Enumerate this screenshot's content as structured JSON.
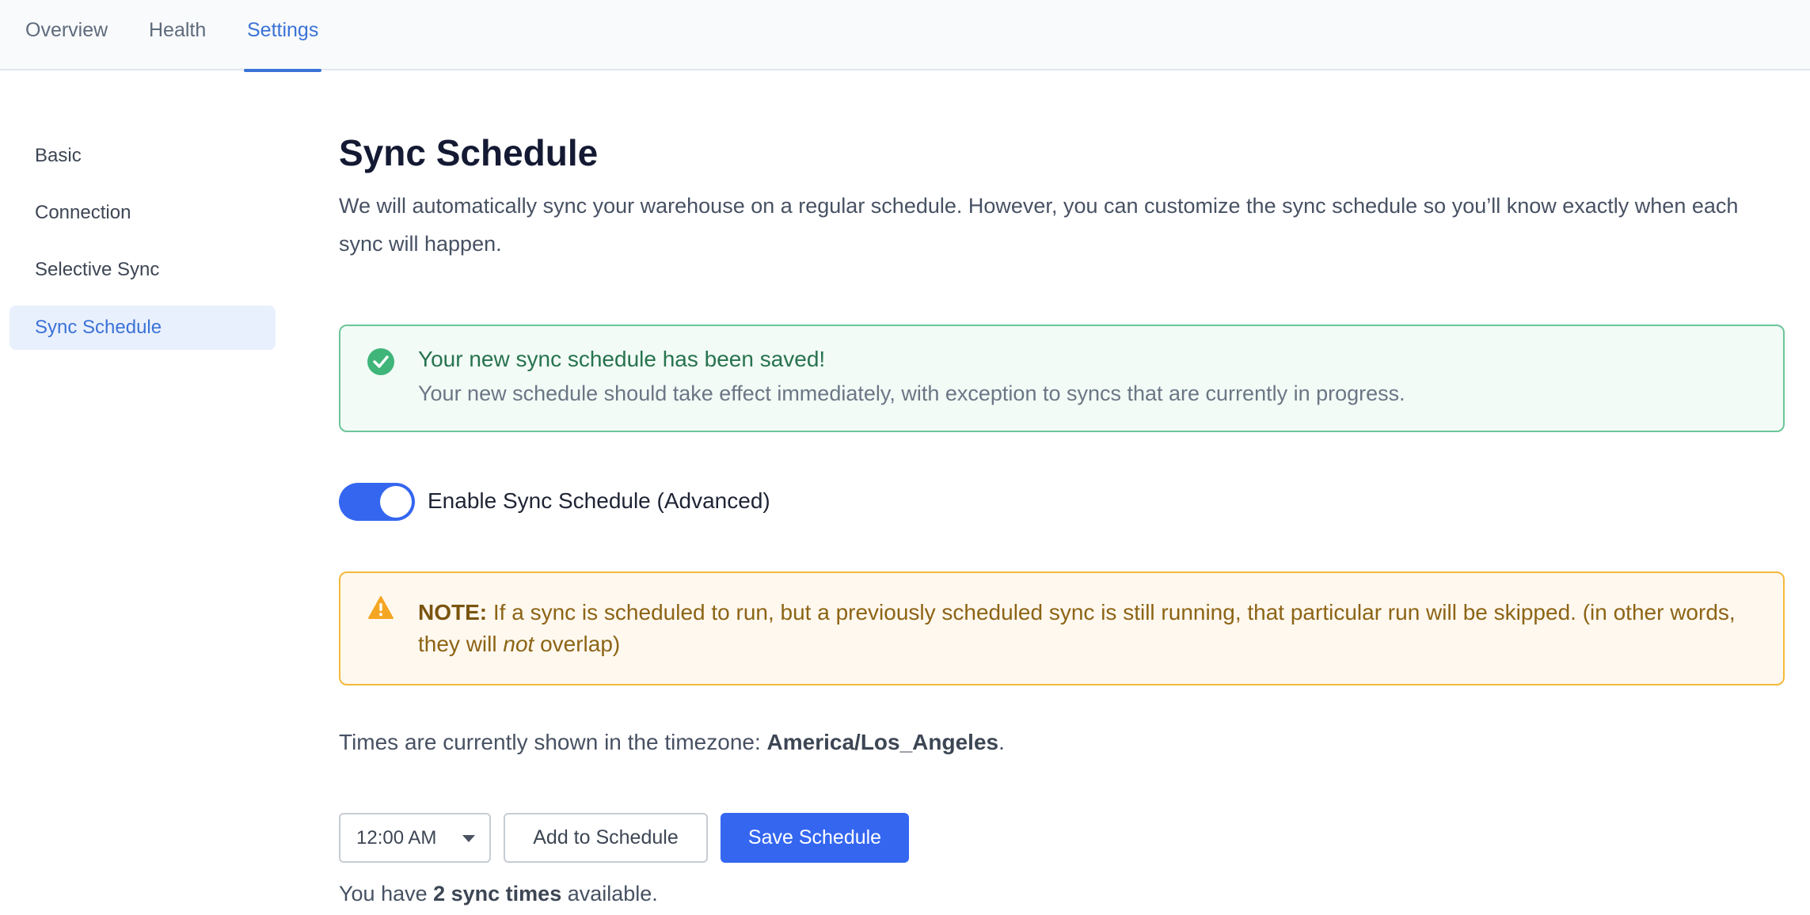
{
  "tabs": [
    {
      "label": "Overview"
    },
    {
      "label": "Health"
    },
    {
      "label": "Settings",
      "active": true
    }
  ],
  "sidebar": {
    "items": [
      {
        "label": "Basic"
      },
      {
        "label": "Connection"
      },
      {
        "label": "Selective Sync"
      },
      {
        "label": "Sync Schedule",
        "active": true
      }
    ]
  },
  "page": {
    "title": "Sync Schedule",
    "description": "We will automatically sync your warehouse on a regular schedule. However, you can customize the sync schedule so you’ll know exactly when each sync will happen."
  },
  "success_alert": {
    "icon": "check-circle-icon",
    "title": "Your new sync schedule has been saved!",
    "body": "Your new schedule should take effect immediately, with exception to syncs that are currently in progress.",
    "color": "#3fb579"
  },
  "toggle": {
    "label": "Enable Sync Schedule (Advanced)",
    "enabled": true,
    "color": "#3466f0"
  },
  "warning_alert": {
    "icon": "warning-icon",
    "prefix": "NOTE:",
    "text_before": " If a sync is scheduled to run, but a previously scheduled sync is still running, that particular run will be skipped. (in other words, they will ",
    "emphasis": "not",
    "text_after": " overlap)",
    "color": "#f2b93a"
  },
  "timezone": {
    "prefix": "Times are currently shown in the timezone: ",
    "value": "America/Los_Angeles",
    "suffix": "."
  },
  "controls": {
    "time_value": "12:00 AM",
    "add_label": "Add to Schedule",
    "save_label": "Save Schedule"
  },
  "footnote": {
    "prefix": "You have ",
    "count_text": "2 sync times",
    "suffix": " available."
  }
}
